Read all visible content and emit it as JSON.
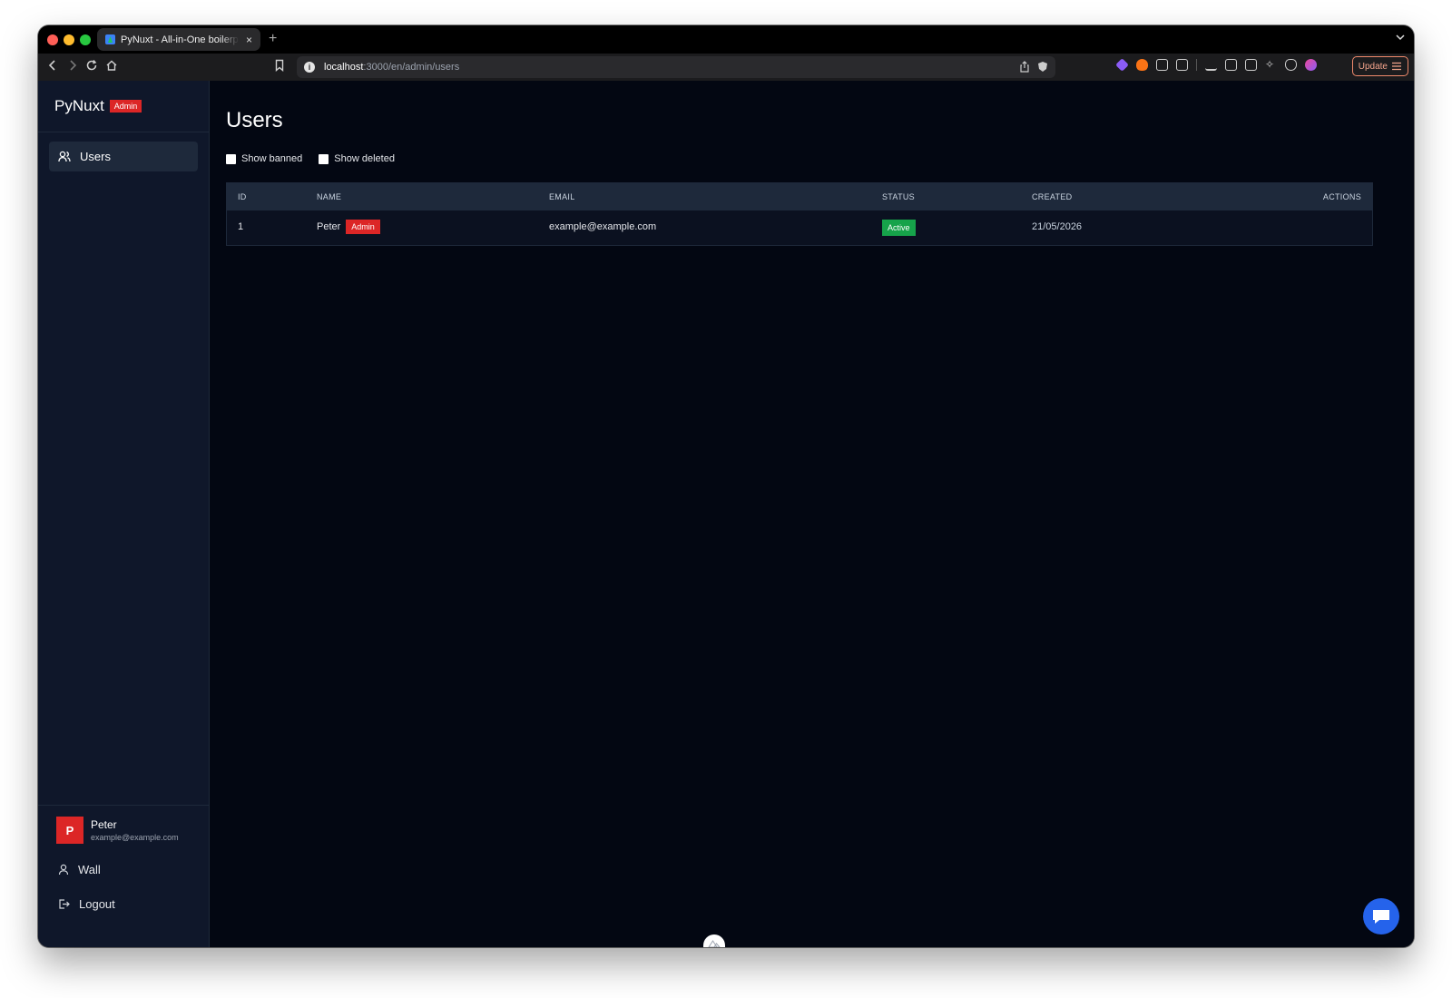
{
  "browser": {
    "tab_title": "PyNuxt - All-in-One boilerplate",
    "tab_close": "×",
    "new_tab": "+",
    "tabs_dropdown": "⌄",
    "url_host": "localhost",
    "url_path": ":3000/en/admin/users",
    "update_label": "Update"
  },
  "sidebar": {
    "brand": "PyNuxt",
    "brand_badge": "Admin",
    "nav_users": "Users",
    "user": {
      "initial": "P",
      "name": "Peter",
      "email": "example@example.com"
    },
    "menu_wall": "Wall",
    "menu_logout": "Logout"
  },
  "main": {
    "title": "Users",
    "filters": {
      "show_banned": "Show banned",
      "show_deleted": "Show deleted"
    },
    "table": {
      "headers": {
        "id": "ID",
        "name": "NAME",
        "email": "EMAIL",
        "status": "STATUS",
        "created": "CREATED",
        "actions": "ACTIONS"
      },
      "rows": [
        {
          "id": "1",
          "name": "Peter",
          "role_badge": "Admin",
          "email": "example@example.com",
          "status": "Active",
          "created": "21/05/2026"
        }
      ]
    }
  },
  "colors": {
    "accent_red": "#dc2626",
    "status_green": "#16a34a",
    "chat_blue": "#2563eb"
  },
  "icons": {
    "users_nav": "users-icon",
    "wall": "user-icon",
    "logout": "logout-icon",
    "chat": "chat-icon"
  }
}
